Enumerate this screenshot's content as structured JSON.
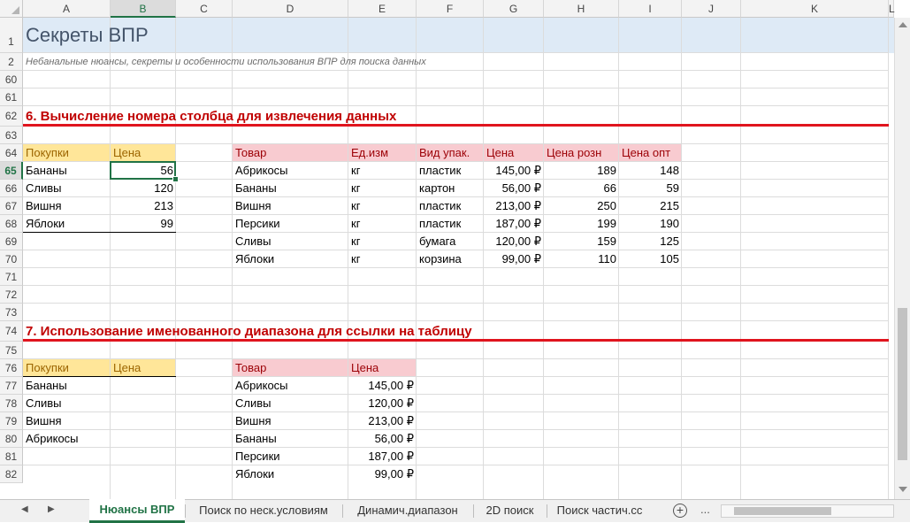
{
  "columns": [
    "A",
    "B",
    "C",
    "D",
    "E",
    "F",
    "G",
    "H",
    "I",
    "J",
    "K",
    "L"
  ],
  "selected_column": "B",
  "rows": [
    {
      "num": "1"
    },
    {
      "num": "2"
    },
    {
      "num": "60"
    },
    {
      "num": "61"
    },
    {
      "num": "62"
    },
    {
      "num": "63"
    },
    {
      "num": "64"
    },
    {
      "num": "65"
    },
    {
      "num": "66"
    },
    {
      "num": "67"
    },
    {
      "num": "68"
    },
    {
      "num": "69"
    },
    {
      "num": "70"
    },
    {
      "num": "71"
    },
    {
      "num": "72"
    },
    {
      "num": "73"
    },
    {
      "num": "74"
    },
    {
      "num": "75"
    },
    {
      "num": "76"
    },
    {
      "num": "77"
    },
    {
      "num": "78"
    },
    {
      "num": "79"
    },
    {
      "num": "80"
    },
    {
      "num": "81"
    },
    {
      "num": "82"
    }
  ],
  "selected_row": "65",
  "title": "Секреты ВПР",
  "subtitle": "Небанальные нюансы, секреты и особенности использования ВПР для поиска данных",
  "section6": {
    "heading": "6. Вычисление номера столбца для извлечения данных",
    "purchases": {
      "headers": [
        "Покупки",
        "Цена"
      ],
      "rows": [
        [
          "Бананы",
          "56"
        ],
        [
          "Сливы",
          "120"
        ],
        [
          "Вишня",
          "213"
        ],
        [
          "Яблоки",
          "99"
        ]
      ]
    },
    "products": {
      "headers": [
        "Товар",
        "Ед.изм",
        "Вид упак.",
        "Цена",
        "Цена розн",
        "Цена опт"
      ],
      "rows": [
        [
          "Абрикосы",
          "кг",
          "пластик",
          "145,00 ₽",
          "189",
          "148"
        ],
        [
          "Бананы",
          "кг",
          "картон",
          "56,00 ₽",
          "66",
          "59"
        ],
        [
          "Вишня",
          "кг",
          "пластик",
          "213,00 ₽",
          "250",
          "215"
        ],
        [
          "Персики",
          "кг",
          "пластик",
          "187,00 ₽",
          "199",
          "190"
        ],
        [
          "Сливы",
          "кг",
          "бумага",
          "120,00 ₽",
          "159",
          "125"
        ],
        [
          "Яблоки",
          "кг",
          "корзина",
          "99,00 ₽",
          "110",
          "105"
        ]
      ]
    }
  },
  "section7": {
    "heading": "7. Использование именованного диапазона для ссылки на таблицу",
    "purchases": {
      "headers": [
        "Покупки",
        "Цена"
      ],
      "rows": [
        [
          "Бананы",
          ""
        ],
        [
          "Сливы",
          ""
        ],
        [
          "Вишня",
          ""
        ],
        [
          "Абрикосы",
          ""
        ]
      ]
    },
    "products": {
      "headers": [
        "Товар",
        "Цена"
      ],
      "rows": [
        [
          "Абрикосы",
          "145,00 ₽"
        ],
        [
          "Сливы",
          "120,00 ₽"
        ],
        [
          "Вишня",
          "213,00 ₽"
        ],
        [
          "Бананы",
          "56,00 ₽"
        ],
        [
          "Персики",
          "187,00 ₽"
        ],
        [
          "Яблоки",
          "99,00 ₽"
        ]
      ]
    }
  },
  "sheet_tabs": [
    "Нюансы ВПР",
    "Поиск по неск.условиям",
    "Динамич.диапазон",
    "2D поиск",
    "Поиск частич.сс"
  ],
  "active_tab": "Нюансы ВПР",
  "nav_prev": "◀",
  "nav_next": "▶",
  "add_sheet": "+",
  "ellipsis": "...",
  "colors": {
    "accent": "#217346",
    "header_yellow": "#ffe699",
    "header_pink": "#f8cbd0",
    "title_band": "#deeaf6",
    "section_red": "#c00000",
    "rule_red": "#e0141e"
  }
}
